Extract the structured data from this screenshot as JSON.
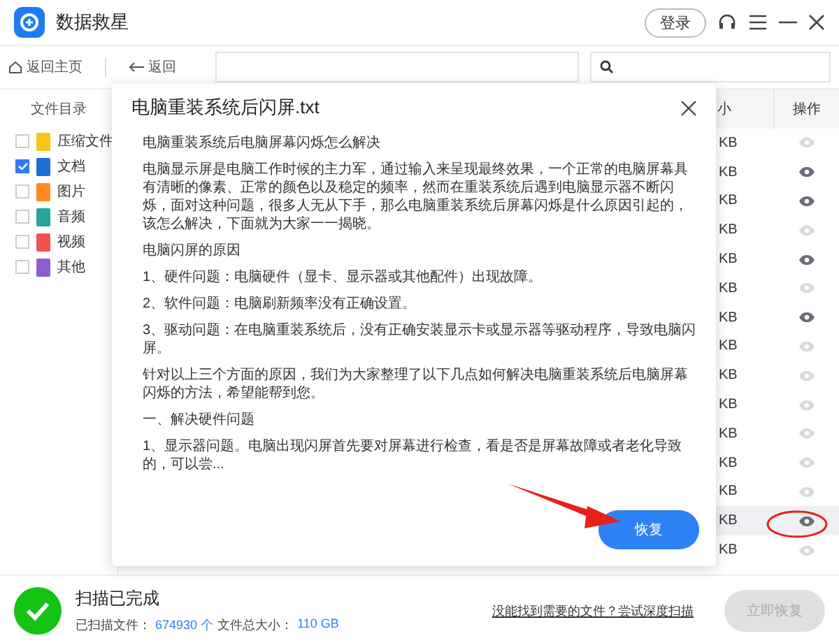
{
  "window": {
    "title": "数据救星",
    "login": "登录"
  },
  "toolbar": {
    "home": "返回主页",
    "back": "返回"
  },
  "sidebar": {
    "header": "文件目录",
    "items": [
      {
        "label": "压缩文件",
        "checked": false,
        "color": "#f5c518"
      },
      {
        "label": "文档",
        "checked": true,
        "color": "#1f6fd6"
      },
      {
        "label": "图片",
        "checked": false,
        "color": "#ff8a1f"
      },
      {
        "label": "音频",
        "checked": false,
        "color": "#26a69a"
      },
      {
        "label": "视频",
        "checked": false,
        "color": "#ef5350"
      },
      {
        "label": "其他",
        "checked": false,
        "color": "#8e5bd6"
      }
    ]
  },
  "table": {
    "columns": [
      "小",
      "操作"
    ],
    "rows": [
      {
        "size": "KB",
        "previewable": false,
        "selected": false
      },
      {
        "size": "KB",
        "previewable": true,
        "selected": false
      },
      {
        "size": "KB",
        "previewable": true,
        "selected": false
      },
      {
        "size": "KB",
        "previewable": false,
        "selected": false
      },
      {
        "size": "KB",
        "previewable": true,
        "selected": false
      },
      {
        "size": "KB",
        "previewable": false,
        "selected": false
      },
      {
        "size": "KB",
        "previewable": true,
        "selected": false
      },
      {
        "size": "KB",
        "previewable": false,
        "selected": false
      },
      {
        "size": "KB",
        "previewable": false,
        "selected": false
      },
      {
        "size": "KB",
        "previewable": false,
        "selected": false
      },
      {
        "size": "KB",
        "previewable": false,
        "selected": false
      },
      {
        "size": "KB",
        "previewable": false,
        "selected": false
      },
      {
        "size": "KB",
        "previewable": false,
        "selected": false
      },
      {
        "size": "KB",
        "previewable": true,
        "selected": true
      },
      {
        "size": "KB",
        "previewable": false,
        "selected": false
      }
    ]
  },
  "dialog": {
    "title": "电脑重装系统后闪屏.txt",
    "paragraphs": [
      "电脑重装系统后电脑屏幕闪烁怎么解决",
      "电脑显示屏是电脑工作时候的主力军，通过输入来呈现最终效果，一个正常的电脑屏幕具有清晰的像素、正常的颜色以及稳定的频率，然而在重装系统后遇到电脑显示器不断闪烁，面对这种问题，很多人无从下手，那么电脑重装系统后屏幕闪烁是什么原因引起的，该怎么解决，下面就为大家一一揭晓。",
      "电脑闪屏的原因",
      "1、硬件问题：电脑硬件（显卡、显示器或其他配件）出现故障。",
      "2、软件问题：电脑刷新频率没有正确设置。",
      "3、驱动问题：在电脑重装系统后，没有正确安装显示卡或显示器等驱动程序，导致电脑闪屏。",
      "针对以上三个方面的原因，我们为大家整理了以下几点如何解决电脑重装系统后电脑屏幕闪烁的方法，希望能帮到您。",
      "一、解决硬件问题",
      "1、显示器问题。电脑出现闪屏首先要对屏幕进行检查，看是否是屏幕故障或者老化导致的，可以尝..."
    ],
    "button": "恢复"
  },
  "status": {
    "title": "扫描已完成",
    "files_label": "已扫描文件：",
    "files_value": "674930 个",
    "size_label": "文件总大小：",
    "size_value": "110 GB",
    "link": "没能找到需要的文件？尝试深度扫描",
    "button": "立即恢复"
  }
}
